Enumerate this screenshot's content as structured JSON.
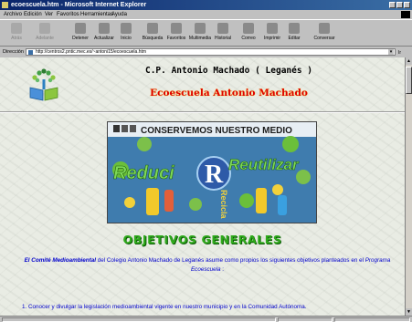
{
  "window": {
    "title": "ecoescuela.htm - Microsoft Internet Explorer"
  },
  "menu": [
    "Archivo",
    "Edición",
    "Ver",
    "Favoritos",
    "Herramientas",
    "Ayuda"
  ],
  "toolbar": {
    "buttons": [
      {
        "label": "Atrás",
        "icon": "back-arrow-icon",
        "enabled": false
      },
      {
        "label": "Adelante",
        "icon": "forward-arrow-icon",
        "enabled": false
      },
      {
        "label": "Detener",
        "icon": "stop-icon",
        "enabled": true
      },
      {
        "label": "Actualizar",
        "icon": "refresh-icon",
        "enabled": true
      },
      {
        "label": "Inicio",
        "icon": "home-icon",
        "enabled": true
      },
      {
        "label": "Búsqueda",
        "icon": "search-icon",
        "enabled": true
      },
      {
        "label": "Favoritos",
        "icon": "favorites-icon",
        "enabled": true
      },
      {
        "label": "Multimedia",
        "icon": "multimedia-icon",
        "enabled": true
      },
      {
        "label": "Historial",
        "icon": "history-icon",
        "enabled": true
      },
      {
        "label": "Correo",
        "icon": "mail-icon",
        "enabled": true
      },
      {
        "label": "Imprimir",
        "icon": "print-icon",
        "enabled": true
      },
      {
        "label": "Editar",
        "icon": "edit-icon",
        "enabled": true
      },
      {
        "label": "Conversar",
        "icon": "discuss-icon",
        "enabled": true
      }
    ]
  },
  "address": {
    "label": "Dirección",
    "url": "http://centros2.pntic.mec.es/~antoni15/ecoescuela.htm",
    "go": "Ir"
  },
  "page": {
    "school_name": "C.P. Antonio Machado ( Leganés )",
    "ecoescuela_title": "Ecoescuela Antonio Machado",
    "banner": {
      "top_text": "CONSERVEMOS NUESTRO MEDIO",
      "left_word": "Reduci",
      "center_letter": "R",
      "right_word": "Reutilizar",
      "vertical_word": "Recicla"
    },
    "objectives_title": "OBJETIVOS GENERALES",
    "intro": {
      "committee": "El Comité Medioambiental",
      "text1": " del Colegio Antonio Machado de Leganés  asume como propios los siguientes  objetivos planteados en el ",
      "program": "Programa Ecoescuela",
      "text2": " :"
    },
    "objectives": [
      "1.  Conocer y divulgar la legislación medioambiental vigente en nuestro municipio y en la Comunidad Autónoma."
    ]
  },
  "colors": {
    "school_name": "#000000",
    "ecoescuela_title": "#e00000",
    "objectives_title": "#2faa1c",
    "body_text": "#0000cc"
  }
}
